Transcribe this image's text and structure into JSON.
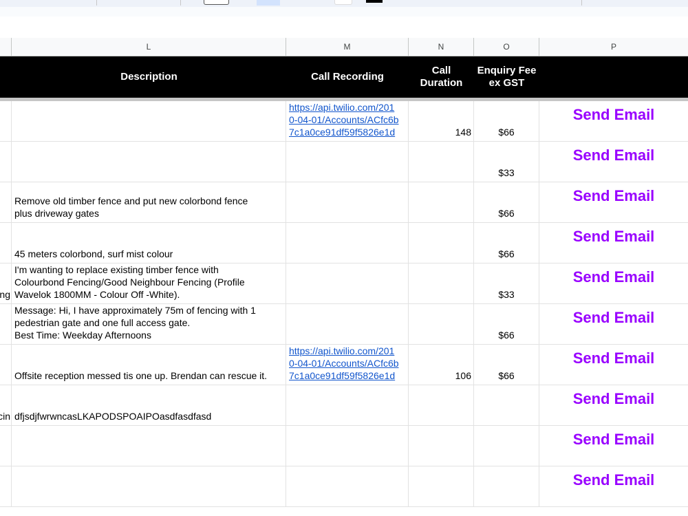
{
  "column_headers": [
    "L",
    "M",
    "N",
    "O",
    "P"
  ],
  "table_headers": {
    "description": "Description",
    "call_recording": "Call Recording",
    "call_duration": [
      "Call",
      "Duration"
    ],
    "enquiry_fee": [
      "Enquiry Fee",
      "ex GST"
    ]
  },
  "rows": [
    {
      "left_clip": "",
      "description": [],
      "recording": [
        "https://api.twilio.com/201",
        "0-04-01/Accounts/ACfc6b",
        "7c1a0ce91df59f5826e1d"
      ],
      "duration": "148",
      "fee": "$66",
      "action": "Send Email"
    },
    {
      "left_clip": "",
      "description": [],
      "recording": [],
      "duration": "",
      "fee": "$33",
      "action": "Send Email"
    },
    {
      "left_clip": "",
      "description": [
        "Remove old timber fence and put new colorbond fence",
        "plus driveway gates"
      ],
      "recording": [],
      "duration": "",
      "fee": "$66",
      "action": "Send Email"
    },
    {
      "left_clip": "",
      "description": [
        "45 meters colorbond, surf mist colour"
      ],
      "recording": [],
      "duration": "",
      "fee": "$66",
      "action": "Send Email"
    },
    {
      "left_clip": "ing",
      "description": [
        "I'm wanting to replace existing timber fence with",
        "Colourbond Fencing/Good Neighbour Fencing (Profile",
        "Wavelok 1800MM - Colour Off -White)."
      ],
      "recording": [],
      "duration": "",
      "fee": "$33",
      "action": "Send Email"
    },
    {
      "left_clip": "",
      "description": [
        "Message: Hi, I have approximately 75m of fencing with 1",
        "pedestrian gate and one full access gate.",
        "Best Time: Weekday Afternoons"
      ],
      "recording": [],
      "duration": "",
      "fee": "$66",
      "action": "Send Email"
    },
    {
      "left_clip": "",
      "description": [
        "Offsite reception messed tis one up. Brendan can rescue it."
      ],
      "recording": [
        "https://api.twilio.com/201",
        "0-04-01/Accounts/ACfc6b",
        "7c1a0ce91df59f5826e1d"
      ],
      "duration": "106",
      "fee": "$66",
      "action": "Send Email"
    },
    {
      "left_clip": "cin",
      "description": [
        "dfjsdjfwrwncasLKAPODSPOAIPOasdfasdfasd"
      ],
      "recording": [],
      "duration": "",
      "fee": "",
      "action": "Send Email"
    },
    {
      "left_clip": "",
      "description": [],
      "recording": [],
      "duration": "",
      "fee": "",
      "action": "Send Email"
    },
    {
      "left_clip": "",
      "description": [],
      "recording": [],
      "duration": "",
      "fee": "",
      "action": "Send Email"
    }
  ],
  "colors": {
    "header_bg": "#000000",
    "header_text": "#ffffff",
    "action_text": "#9900ff",
    "link_text": "#1155cc"
  }
}
